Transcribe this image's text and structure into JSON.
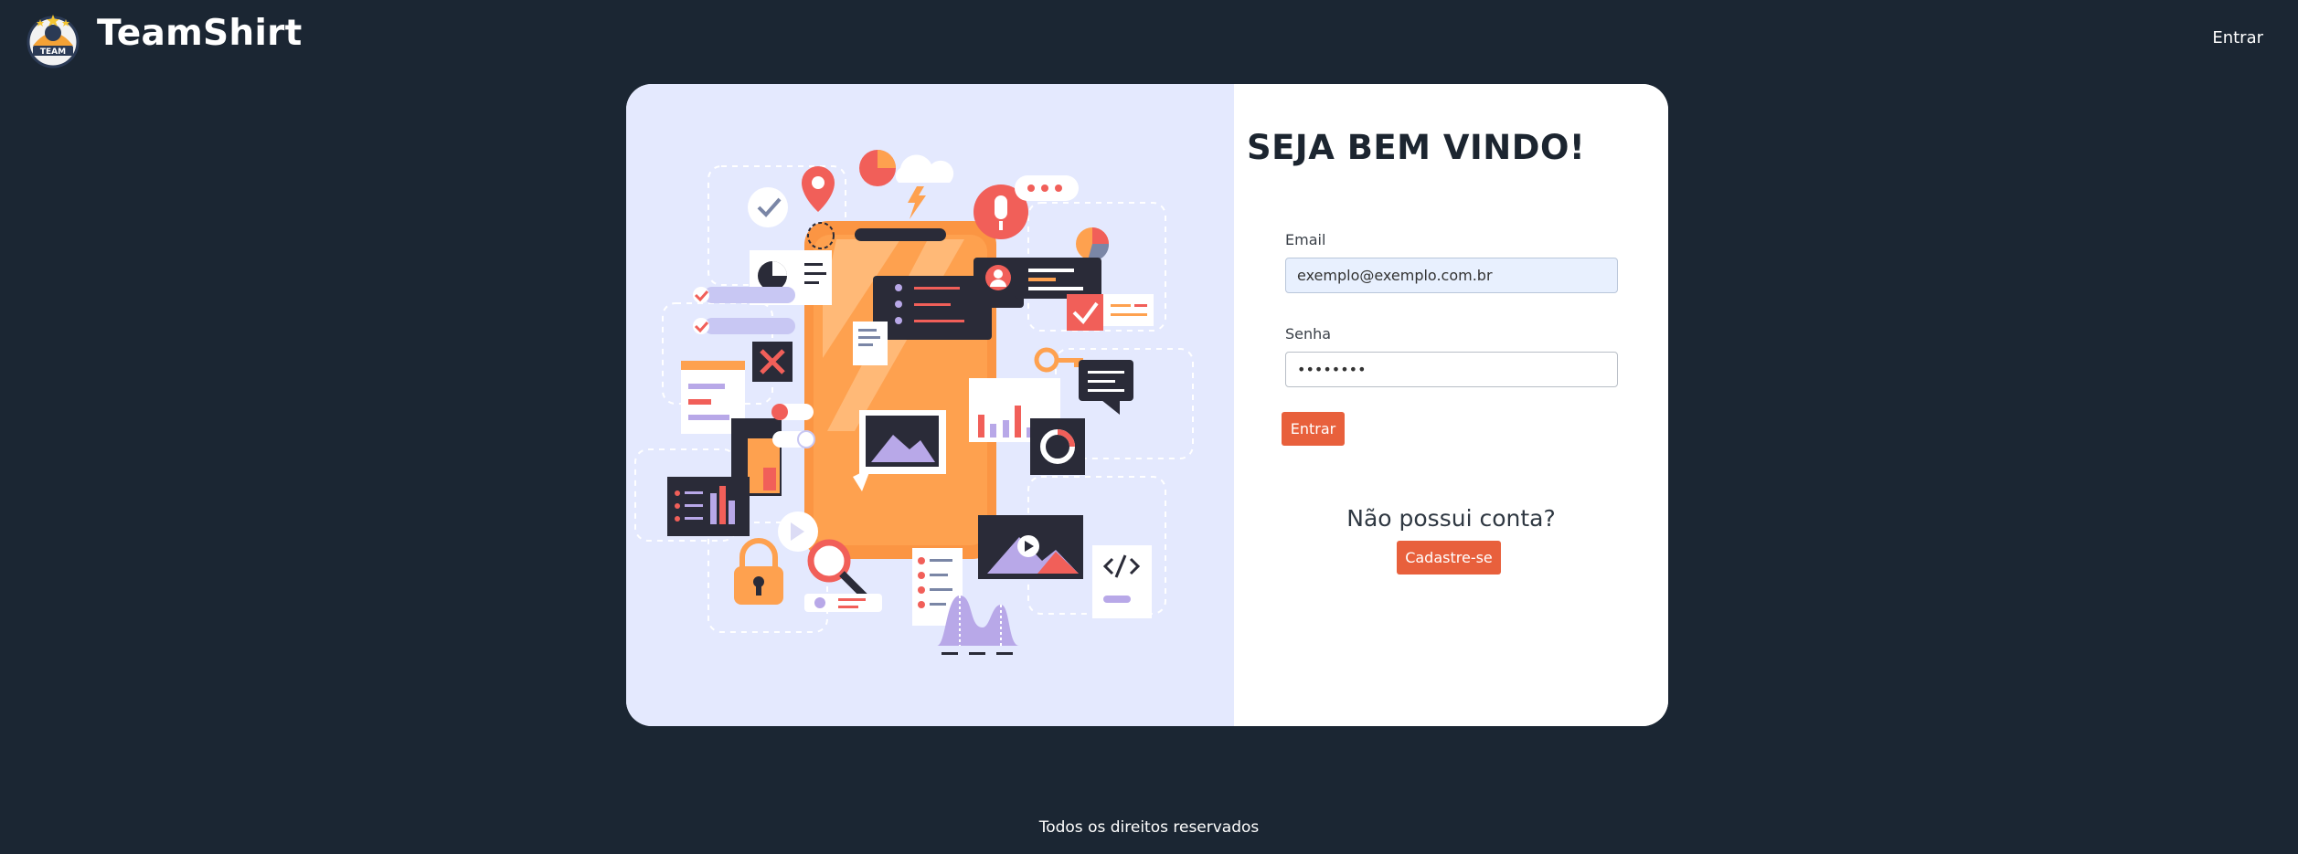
{
  "header": {
    "brand": "TeamShirt",
    "logo_text": "TEAM",
    "nav_login": "Entrar"
  },
  "login": {
    "title": "SEJA BEM VINDO!",
    "email_label": "Email",
    "email_value": "exemplo@exemplo.com.br",
    "password_label": "Senha",
    "password_value": "Senha123",
    "submit_label": "Entrar",
    "no_account_text": "Não possui conta?",
    "signup_label": "Cadastre-se"
  },
  "footer": {
    "text": "Todos os direitos reservados"
  },
  "colors": {
    "background": "#1b2633",
    "accent": "#e8603c",
    "illustration_bg": "#e4e9fe",
    "phone_orange": "#fea14f"
  }
}
